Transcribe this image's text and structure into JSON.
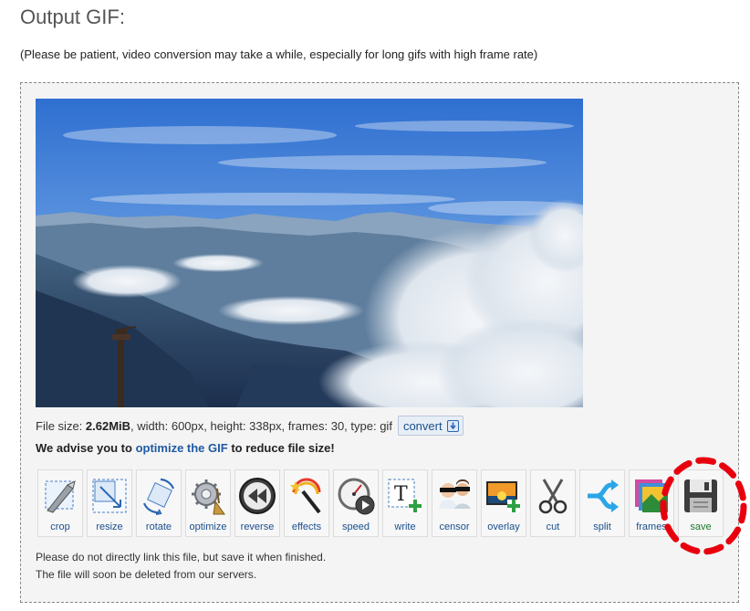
{
  "page": {
    "title": "Output GIF:",
    "note": "(Please be patient, video conversion may take a while, especially for long gifs with high frame rate)"
  },
  "fileinfo": {
    "prefix": "File size: ",
    "size": "2.62MiB",
    "rest": ", width: 600px, height: 338px, frames: 30, type: gif",
    "convert_label": "convert"
  },
  "advise": {
    "before": "We advise you to ",
    "link": "optimize the GIF",
    "after": " to reduce file size!"
  },
  "tools": [
    {
      "label": "crop",
      "icon": "crop-icon"
    },
    {
      "label": "resize",
      "icon": "resize-icon"
    },
    {
      "label": "rotate",
      "icon": "rotate-icon"
    },
    {
      "label": "optimize",
      "icon": "optimize-icon"
    },
    {
      "label": "reverse",
      "icon": "reverse-icon"
    },
    {
      "label": "effects",
      "icon": "effects-icon"
    },
    {
      "label": "speed",
      "icon": "speed-icon"
    },
    {
      "label": "write",
      "icon": "write-icon"
    },
    {
      "label": "censor",
      "icon": "censor-icon"
    },
    {
      "label": "overlay",
      "icon": "overlay-icon"
    },
    {
      "label": "cut",
      "icon": "cut-icon"
    },
    {
      "label": "split",
      "icon": "split-icon"
    },
    {
      "label": "frames",
      "icon": "frames-icon"
    },
    {
      "label": "save",
      "icon": "save-icon"
    }
  ],
  "footer": {
    "line1": "Please do not directly link this file, but save it when finished.",
    "line2": "The file will soon be deleted from our servers."
  },
  "colors": {
    "link": "#1f5aa3",
    "highlight": "#e8000e",
    "save_label": "#1a7a2a"
  }
}
